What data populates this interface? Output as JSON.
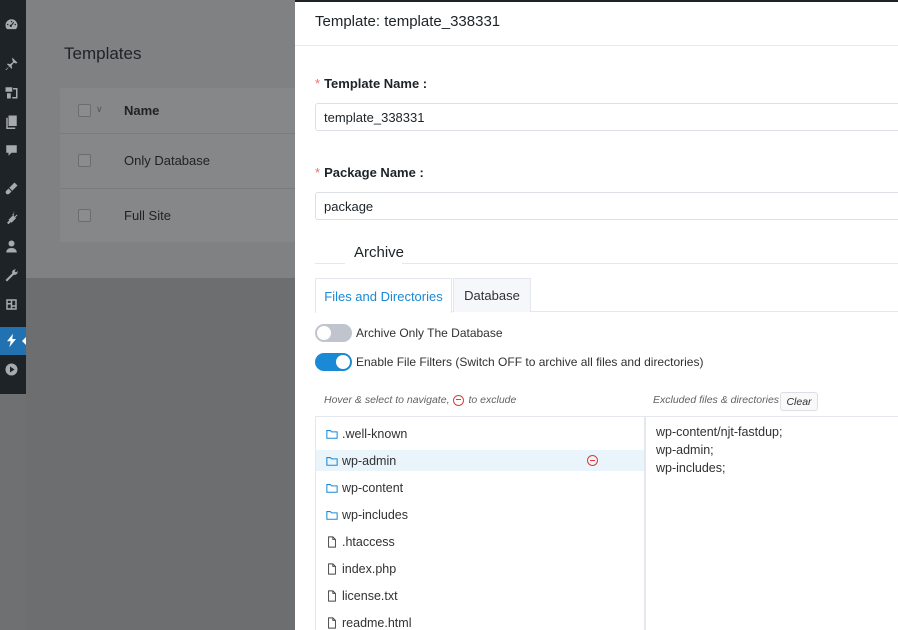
{
  "sidebar": {
    "items": [
      "dashboard-icon",
      "pin-icon",
      "media-icon",
      "pages-icon",
      "comments-icon",
      "appearance-icon",
      "plugins-icon",
      "users-icon",
      "tools-icon",
      "settings-icon",
      "fastdup-icon",
      "play-icon"
    ]
  },
  "background": {
    "title": "Templates",
    "columns": [
      "Name"
    ],
    "rows": [
      "Only Database",
      "Full Site"
    ]
  },
  "drawer": {
    "title": "Template: template_338331",
    "template_name_label": "Template Name :",
    "template_name_value": "template_338331",
    "package_name_label": "Package Name :",
    "package_name_value": "package",
    "required_mark": "*",
    "section_title": "Archive",
    "tabs": [
      "Files and Directories",
      "Database"
    ],
    "switches": [
      {
        "label": "Archive Only The Database",
        "on": false
      },
      {
        "label": "Enable File Filters (Switch OFF to archive all files and directories)",
        "on": true
      }
    ],
    "hint_prefix": "Hover & select to navigate,",
    "hint_suffix": "to exclude",
    "excluded_header": "Excluded files & directories",
    "clear_label": "Clear",
    "tree": [
      {
        "name": ".well-known",
        "type": "folder"
      },
      {
        "name": "wp-admin",
        "type": "folder"
      },
      {
        "name": "wp-content",
        "type": "folder"
      },
      {
        "name": "wp-includes",
        "type": "folder"
      },
      {
        "name": ".htaccess",
        "type": "file"
      },
      {
        "name": "index.php",
        "type": "file"
      },
      {
        "name": "license.txt",
        "type": "file"
      },
      {
        "name": "readme.html",
        "type": "file"
      }
    ],
    "excluded": [
      "wp-content/njt-fastdup;",
      "wp-admin;",
      "wp-includes;"
    ],
    "accent_color": "#1a8ad6",
    "required_color": "#f56c6c"
  }
}
